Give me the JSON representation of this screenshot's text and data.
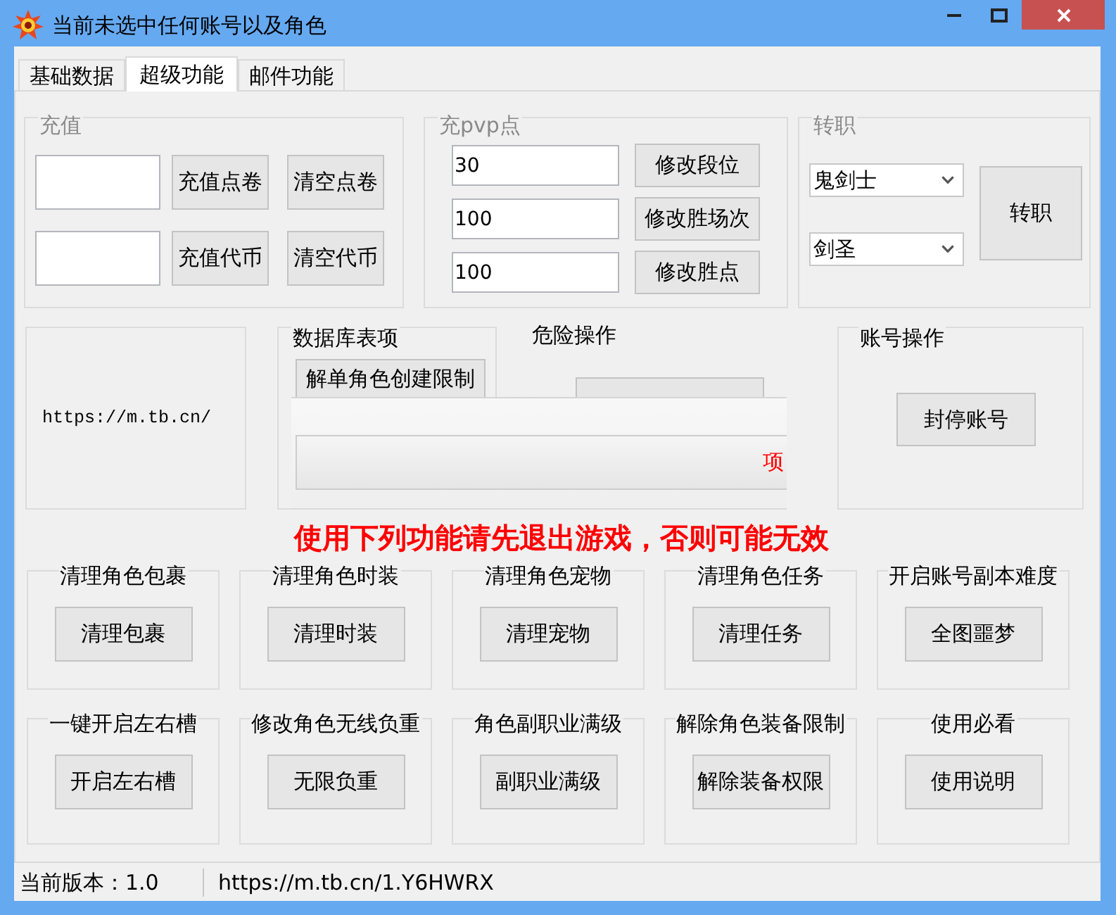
{
  "window": {
    "title": "当前未选中任何账号以及角色"
  },
  "tabs": [
    {
      "label": "基础数据",
      "selected": false
    },
    {
      "label": "超级功能",
      "selected": true
    },
    {
      "label": "邮件功能",
      "selected": false
    }
  ],
  "recharge": {
    "title": "充值",
    "rows": [
      {
        "buttons": [
          "充值点卷",
          "清空点卷"
        ]
      },
      {
        "buttons": [
          "充值代币",
          "清空代币"
        ]
      }
    ]
  },
  "pvp": {
    "title": "充pvp点",
    "rows": [
      {
        "value": "30",
        "button": "修改段位"
      },
      {
        "value": "100",
        "button": "修改胜场次"
      },
      {
        "value": "100",
        "button": "修改胜点"
      }
    ]
  },
  "job_change": {
    "title": "转职",
    "dropdowns": [
      {
        "value": "鬼剑士"
      },
      {
        "value": "剑圣"
      }
    ],
    "button": "转职"
  },
  "link_panel": {
    "text": "https://m.tb.cn/"
  },
  "database": {
    "title": "数据库表项",
    "button": "解单角色创建限制"
  },
  "danger": {
    "title": "危险操作",
    "wide_button": "项"
  },
  "account": {
    "title": "账号操作",
    "button": "封停账号"
  },
  "warning": "使用下列功能请先退出游戏，否则可能无效",
  "function_groups": [
    {
      "title": "清理角色包裹",
      "button": "清理包裹"
    },
    {
      "title": "清理角色时装",
      "button": "清理时装"
    },
    {
      "title": "清理角色宠物",
      "button": "清理宠物"
    },
    {
      "title": "清理角色任务",
      "button": "清理任务"
    },
    {
      "title": "开启账号副本难度",
      "button": "全图噩梦"
    },
    {
      "title": "一键开启左右槽",
      "button": "开启左右槽"
    },
    {
      "title": "修改角色无线负重",
      "button": "无限负重"
    },
    {
      "title": "角色副职业满级",
      "button": "副职业满级"
    },
    {
      "title": "解除角色装备限制",
      "button": "解除装备权限"
    },
    {
      "title": "使用必看",
      "button": "使用说明"
    }
  ],
  "status_bar": {
    "version": "当前版本：1.0",
    "link": "https://m.tb.cn/1.Y6HWRX"
  }
}
